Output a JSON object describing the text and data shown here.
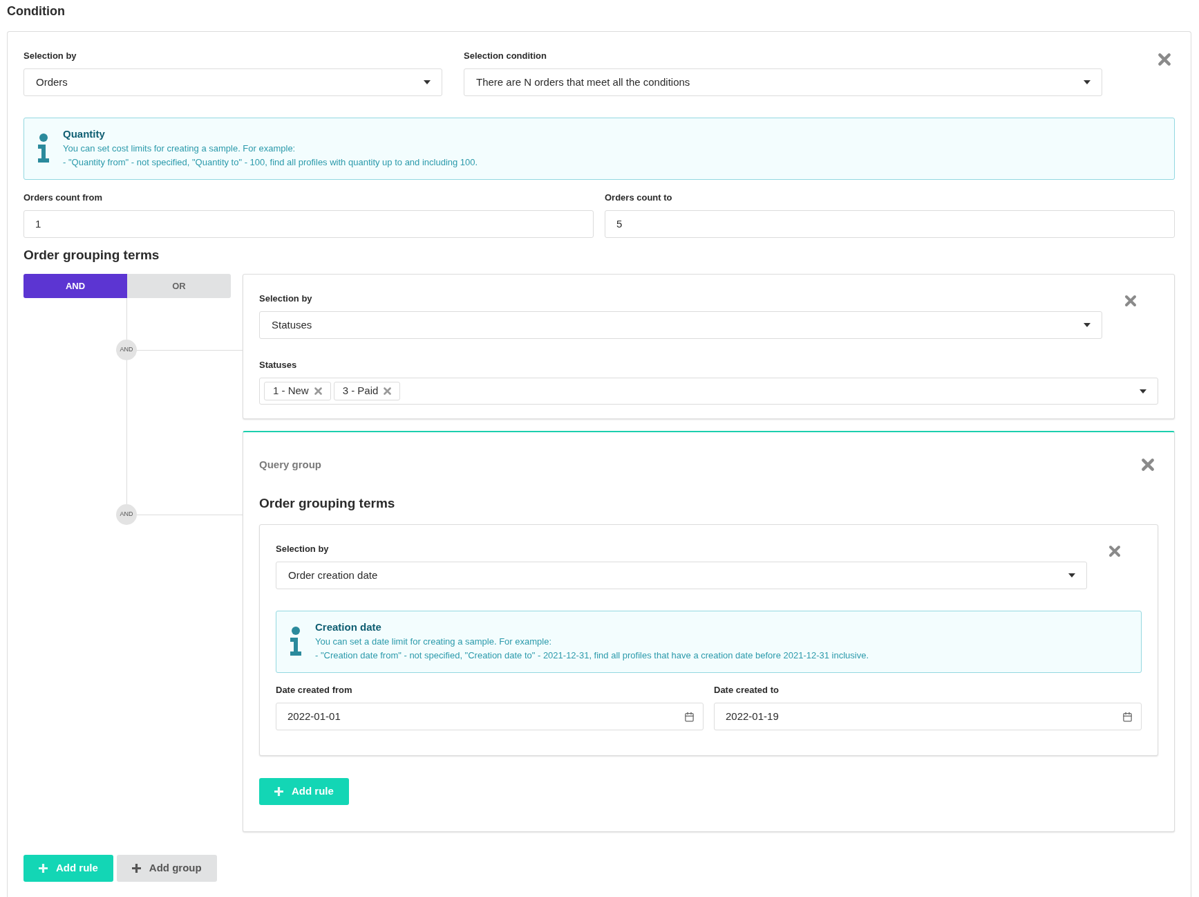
{
  "title": "Condition",
  "fields": [
    {
      "label": "Selection by",
      "value": "Orders"
    },
    {
      "label": "Selection condition",
      "value": "There are N orders that meet all the conditions"
    }
  ],
  "info": {
    "title": "Quantity",
    "lines": [
      "You can set cost limits for creating a sample. For example:",
      "- \"Quantity from\" - not specified, \"Quantity to\" - 100, find all profiles with quantity up to and including 100."
    ]
  },
  "range": [
    {
      "label": "Orders count from",
      "value": "1"
    },
    {
      "label": "Orders count to",
      "value": "5"
    }
  ],
  "grouping": {
    "heading": "Order grouping terms",
    "operators": [
      {
        "label": "AND",
        "selected": true
      },
      {
        "label": "OR",
        "selected": false
      }
    ],
    "items": [
      {
        "kind": "rule",
        "connector": "AND",
        "selection": {
          "label": "Selection by",
          "value": "Statuses"
        },
        "statuses": {
          "label": "Statuses",
          "tags": [
            "1 - New",
            "3 - Paid"
          ]
        }
      },
      {
        "kind": "group",
        "connector": "AND",
        "title": "Query group",
        "heading": "Order grouping terms",
        "items": [
          {
            "kind": "rule",
            "selection": {
              "label": "Selection by",
              "value": "Order creation date"
            },
            "info": {
              "title": "Creation date",
              "lines": [
                "You can set a date limit for creating a sample. For example:",
                "- \"Creation date from\" - not specified, \"Creation date to\" - 2021-12-31, find all profiles that have a creation date before 2021-12-31 inclusive."
              ]
            },
            "dates": [
              {
                "label": "Date created from",
                "value": "2022-01-01"
              },
              {
                "label": "Date created to",
                "value": "2022-01-19"
              }
            ]
          }
        ],
        "buttons": [
          {
            "label": "Add rule",
            "kind": "primary"
          }
        ]
      }
    ],
    "buttons": [
      {
        "label": "Add rule",
        "kind": "primary"
      },
      {
        "label": "Add group",
        "kind": "secondary"
      }
    ]
  }
}
